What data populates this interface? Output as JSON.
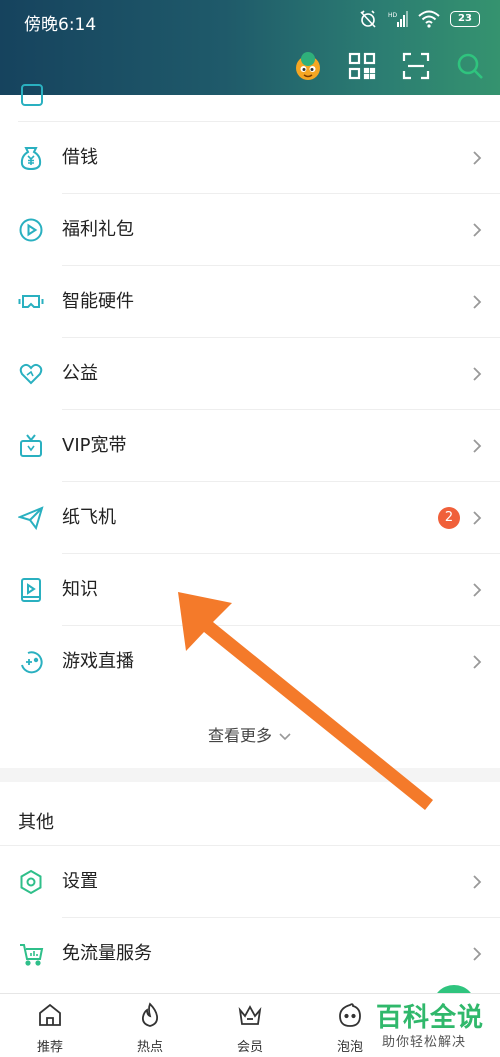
{
  "status_bar": {
    "time": "傍晚6:14",
    "battery": "23"
  },
  "header": {
    "tools": [
      "avatar-icon",
      "qr-code-icon",
      "scan-icon",
      "search-icon"
    ],
    "accent_color": "#2fc47e"
  },
  "menu": {
    "items": [
      {
        "label": "借钱",
        "icon": "money-bag-icon"
      },
      {
        "label": "福利礼包",
        "icon": "play-circle-icon"
      },
      {
        "label": "智能硬件",
        "icon": "vr-glasses-icon"
      },
      {
        "label": "公益",
        "icon": "heart-icon"
      },
      {
        "label": "VIP宽带",
        "icon": "tv-icon"
      },
      {
        "label": "纸飞机",
        "icon": "paper-plane-icon",
        "badge": "2"
      },
      {
        "label": "知识",
        "icon": "book-icon"
      },
      {
        "label": "游戏直播",
        "icon": "gamepad-icon"
      }
    ],
    "more_label": "查看更多"
  },
  "other": {
    "title": "其他",
    "items": [
      {
        "label": "设置",
        "icon": "gear-icon"
      },
      {
        "label": "免流量服务",
        "icon": "cart-icon"
      }
    ]
  },
  "bottom_nav": [
    {
      "label": "推荐",
      "icon": "home-icon"
    },
    {
      "label": "热点",
      "icon": "flame-icon"
    },
    {
      "label": "会员",
      "icon": "crown-icon"
    },
    {
      "label": "泡泡",
      "icon": "bubble-face-icon"
    }
  ],
  "watermark": {
    "title": "百科全说",
    "subtitle": "助你轻松解决"
  },
  "annotation": {
    "arrow_color": "#f47a2a"
  }
}
